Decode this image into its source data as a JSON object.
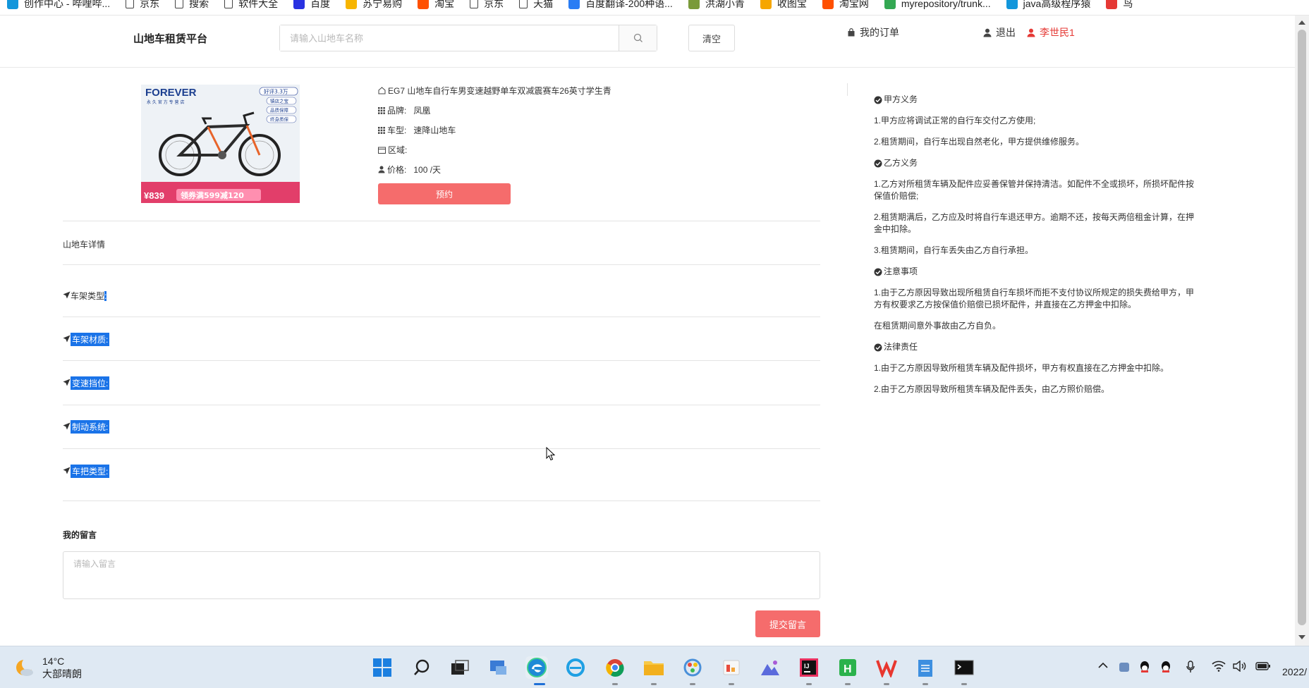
{
  "bookmarks": [
    {
      "label": "创作中心 - 哔哩哔...",
      "icon": "bilibili-icon",
      "color": "#1296db"
    },
    {
      "label": "京东",
      "icon": "page-icon"
    },
    {
      "label": "搜索",
      "icon": "page-icon"
    },
    {
      "label": "软件大全",
      "icon": "page-icon"
    },
    {
      "label": "百度",
      "icon": "baidu-icon",
      "color": "#2932e1"
    },
    {
      "label": "苏宁易购",
      "icon": "suning-icon",
      "color": "#f7b500"
    },
    {
      "label": "淘宝",
      "icon": "taobao-icon",
      "color": "#ff5000"
    },
    {
      "label": "京东",
      "icon": "page-icon"
    },
    {
      "label": "天猫",
      "icon": "page-icon"
    },
    {
      "label": "百度翻译-200种语...",
      "icon": "translate-icon",
      "color": "#2a7df4"
    },
    {
      "label": "洪湖小青",
      "icon": "leaf-icon",
      "color": "#7a9a3a"
    },
    {
      "label": "收图宝",
      "icon": "image-icon",
      "color": "#f6a600"
    },
    {
      "label": "淘宝网",
      "icon": "taobao-icon",
      "color": "#ff5000"
    },
    {
      "label": "myrepository/trunk...",
      "icon": "chrome-icon",
      "color": "#34a853"
    },
    {
      "label": "java高级程序猿",
      "icon": "bilibili-icon",
      "color": "#1296db"
    },
    {
      "label": "鸟",
      "icon": "bird-icon",
      "color": "#e53935"
    }
  ],
  "header": {
    "logo": "山地车租赁平台",
    "search_placeholder": "请输入山地车名称",
    "clear_label": "清空",
    "orders_label": "我的订单",
    "logout_label": "退出",
    "username": "李世民1"
  },
  "product": {
    "image_text": {
      "brand": "FOREVER",
      "sub": "永 久 官 方 专 营 店",
      "badges": [
        "好评3.3万",
        "镇店之宝",
        "品质保障",
        "终身质保"
      ],
      "price": "¥839",
      "coupon": "领券满599减120"
    },
    "name": "EG7 山地车自行车男变速越野单车双减震赛车26英寸学生青",
    "brand_label": "品牌:",
    "brand_value": "凤凰",
    "type_label": "车型:",
    "type_value": "速降山地车",
    "area_label": "区域:",
    "area_value": "",
    "price_label": "价格:",
    "price_value": "100 /天",
    "reserve_label": "预约"
  },
  "details": {
    "title": "山地车详情",
    "specs": [
      {
        "label": "车架类型",
        "colon": ":"
      },
      {
        "label": "车架材质",
        "colon": ":"
      },
      {
        "label": "变速挡位",
        "colon": ":"
      },
      {
        "label": "制动系统",
        "colon": ":"
      },
      {
        "label": "车把类型",
        "colon": ":"
      }
    ]
  },
  "message": {
    "title": "我的留言",
    "placeholder": "请输入留言",
    "submit_label": "提交留言"
  },
  "terms": {
    "sections": [
      {
        "title": "甲方义务",
        "items": [
          "1.甲方应将调试正常的自行车交付乙方使用;",
          "2.租赁期间，自行车出现自然老化，甲方提供维修服务。"
        ]
      },
      {
        "title": "乙方义务",
        "items": [
          "1.乙方对所租赁车辆及配件应妥善保管并保持清洁。如配件不全或损坏，所损坏配件按保值价赔偿;",
          "2.租赁期满后，乙方应及时将自行车退还甲方。逾期不还，按每天两倍租金计算，在押金中扣除。",
          "3.租赁期间，自行车丢失由乙方自行承担。"
        ]
      },
      {
        "title": "注意事项",
        "items": [
          "1.由于乙方原因导致出现所租赁自行车损坏而拒不支付协议所规定的损失费给甲方，甲方有权要求乙方按保值价赔偿已损坏配件，并直接在乙方押金中扣除。",
          "在租赁期间意外事故由乙方自负。"
        ]
      },
      {
        "title": "法律责任",
        "items": [
          "1.由于乙方原因导致所租赁车辆及配件损坏，甲方有权直接在乙方押金中扣除。",
          "2.由于乙方原因导致所租赁车辆及配件丢失，由乙方照价赔偿。"
        ]
      }
    ]
  },
  "taskbar": {
    "temperature": "14°C",
    "weather": "大部晴朗",
    "clock": "2022/"
  },
  "colors": {
    "accent": "#f56c6c",
    "danger": "#e53935",
    "select": "#1a73e8"
  }
}
